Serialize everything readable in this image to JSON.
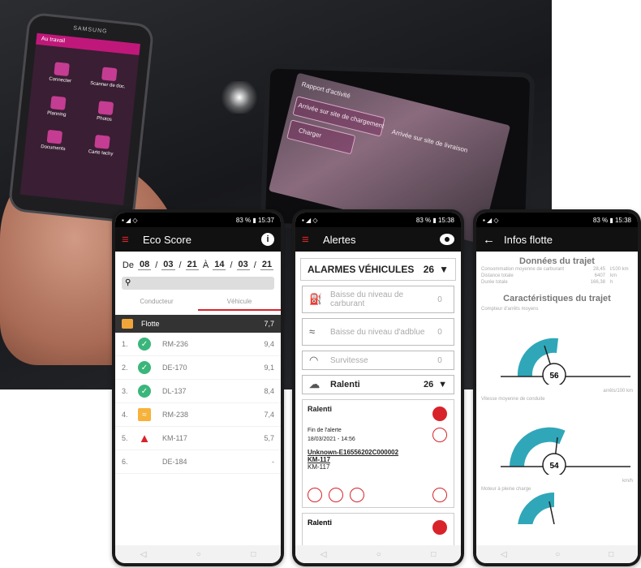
{
  "photo": {
    "phone_brand": "SAMSUNG",
    "phone_app_title": "Au travail",
    "phone_tiles": [
      "Connecter",
      "Scanner de doc.",
      "Planning",
      "Photos",
      "Documents",
      "Carte tachy"
    ],
    "dashboard_labels": [
      "Rapport d'activité",
      "Arrivée sur site de chargement",
      "Charger",
      "Arrivée sur site de livraison"
    ]
  },
  "eco": {
    "status_time": "15:37",
    "status_battery": "83 %",
    "title": "Eco Score",
    "date_from_label": "De",
    "date_from": [
      "08",
      "03",
      "21"
    ],
    "date_to_label": "À",
    "date_to": [
      "14",
      "03",
      "21"
    ],
    "search_icon": "search-icon",
    "tabs": [
      "Conducteur",
      "Véhicule"
    ],
    "fleet_label": "Flotte",
    "fleet_value": "7,7",
    "rows": [
      {
        "rank": "1.",
        "status": "ok",
        "name": "RM-236",
        "value": "9,4"
      },
      {
        "rank": "2.",
        "status": "ok",
        "name": "DE-170",
        "value": "9,1"
      },
      {
        "rank": "3.",
        "status": "ok",
        "name": "DL-137",
        "value": "8,4"
      },
      {
        "rank": "4.",
        "status": "warn",
        "name": "RM-238",
        "value": "7,4"
      },
      {
        "rank": "5.",
        "status": "alert",
        "name": "KM-117",
        "value": "5,7"
      },
      {
        "rank": "6.",
        "status": "none",
        "name": "DE-184",
        "value": "-"
      }
    ]
  },
  "alertes": {
    "status_time": "15:38",
    "status_battery": "83 %",
    "title": "Alertes",
    "section_label": "ALARMES VÉHICULES",
    "section_count": "26",
    "cards": [
      {
        "label": "Baisse du niveau de carburant",
        "count": "0",
        "icon": "fuel-icon"
      },
      {
        "label": "Baisse du niveau d'adblue",
        "count": "0",
        "icon": "adblue-icon"
      },
      {
        "label": "Survitesse",
        "count": "0",
        "icon": "speedometer-icon"
      }
    ],
    "ralenti_label": "Ralenti",
    "ralenti_count": "26",
    "detail_title": "Ralenti",
    "detail_sub": "Fin de l'alerte",
    "detail_date": "18/03/2021 - 14:56",
    "detail_link": "Unknown-E16556202C000002",
    "detail_link2": "KM-117",
    "detail_vehicle": "KM-117",
    "detail2_title": "Ralenti"
  },
  "infos": {
    "status_time": "15:38",
    "status_battery": "83 %",
    "title": "Infos flotte",
    "section1": "Données du trajet",
    "kv": [
      {
        "k": "Consommation moyenne de carburant",
        "v": "28,45",
        "u": "l/100 km"
      },
      {
        "k": "Distance totale",
        "v": "6407",
        "u": "km"
      },
      {
        "k": "Durée totale",
        "v": "166,38",
        "u": "h"
      }
    ],
    "section2": "Caractéristiques du trajet",
    "gauge1_label": "Compteur d'arrêts moyens",
    "gauge1_value": "56",
    "gauge1_unit": "arrêts/100 km",
    "gauge2_label": "Vitesse moyenne de conduite",
    "gauge2_value": "54",
    "gauge2_unit": "km/h",
    "gauge3_label": "Moteur à pleine charge"
  },
  "colors": {
    "accent": "#d8232a",
    "ok": "#3bb67a",
    "warn": "#f6b23a",
    "gauge": "#2fa7b9"
  }
}
